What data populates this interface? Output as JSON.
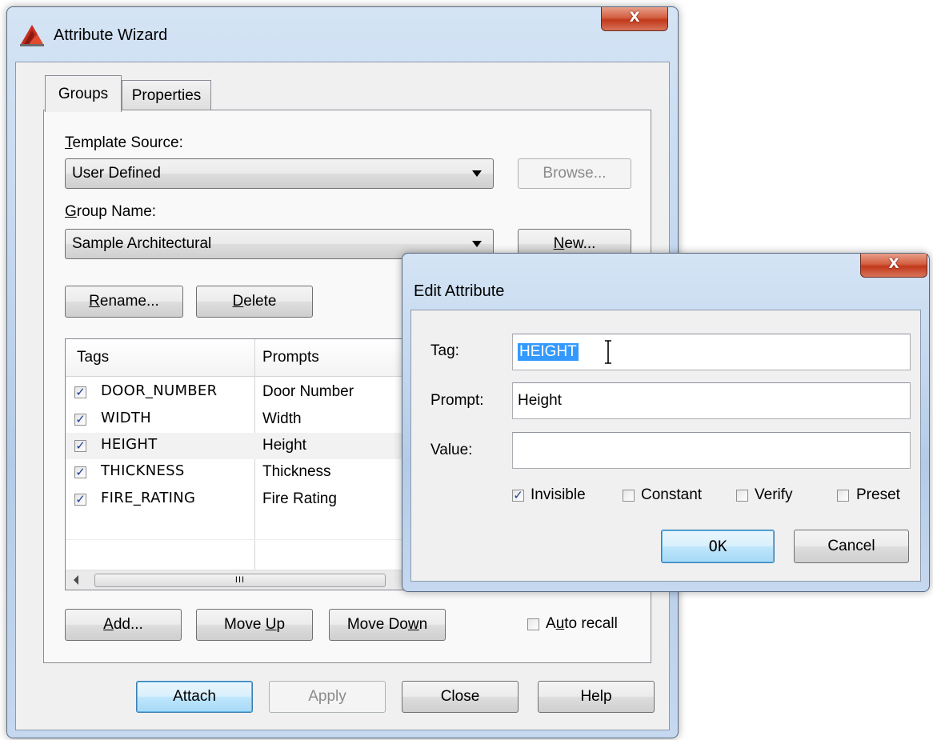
{
  "wizard": {
    "title": "Attribute Wizard",
    "close_glyph": "X",
    "tabs": [
      {
        "label": "Groups",
        "active": true
      },
      {
        "label": "Properties",
        "active": false
      }
    ],
    "template_source": {
      "label_mnemonic": "T",
      "label_rest": "emplate Source:",
      "value": "User Defined",
      "browse_label": "Browse..."
    },
    "group_name": {
      "label_mnemonic": "G",
      "label_rest": "roup Name:",
      "value": "Sample Architectural",
      "new_mnemonic": "N",
      "new_rest": "ew..."
    },
    "rename": {
      "mnemonic": "R",
      "rest": "ename..."
    },
    "delete": {
      "mnemonic": "D",
      "rest": "elete"
    },
    "table": {
      "columns": [
        "Tags",
        "Prompts"
      ],
      "rows": [
        {
          "tag": "DOOR_NUMBER",
          "prompt": "Door Number",
          "checked": true
        },
        {
          "tag": "WIDTH",
          "prompt": "Width",
          "checked": true
        },
        {
          "tag": "HEIGHT",
          "prompt": "Height",
          "checked": true
        },
        {
          "tag": "THICKNESS",
          "prompt": "Thickness",
          "checked": true
        },
        {
          "tag": "FIRE_RATING",
          "prompt": "Fire Rating",
          "checked": true
        }
      ],
      "scroll_thumb_glyph": "III"
    },
    "add": {
      "mnemonic": "A",
      "rest": "dd..."
    },
    "move_up": {
      "before": "Move ",
      "mnemonic": "U",
      "rest": "p"
    },
    "move_down": {
      "before": "Move Do",
      "mnemonic": "w",
      "rest": "n"
    },
    "auto_recall": {
      "before": "A",
      "mnemonic": "u",
      "rest": "to recall",
      "checked": false
    },
    "footer": {
      "attach": "Attach",
      "apply": "Apply",
      "close": "Close",
      "help": "Help"
    }
  },
  "edit_attribute": {
    "title": "Edit Attribute",
    "close_glyph": "X",
    "tag_label": "Tag:",
    "tag_value": "HEIGHT",
    "prompt_label": "Prompt:",
    "prompt_value": "Height",
    "value_label": "Value:",
    "value_value": "",
    "options": [
      {
        "label": "Invisible",
        "checked": true
      },
      {
        "label": "Constant",
        "checked": false
      },
      {
        "label": "Verify",
        "checked": false
      },
      {
        "label": "Preset",
        "checked": false
      }
    ],
    "ok_label": "OK",
    "cancel_label": "Cancel"
  },
  "colors": {
    "selection": "#3399ff",
    "check": "#1c3f94",
    "close_button": "#c1381b"
  }
}
